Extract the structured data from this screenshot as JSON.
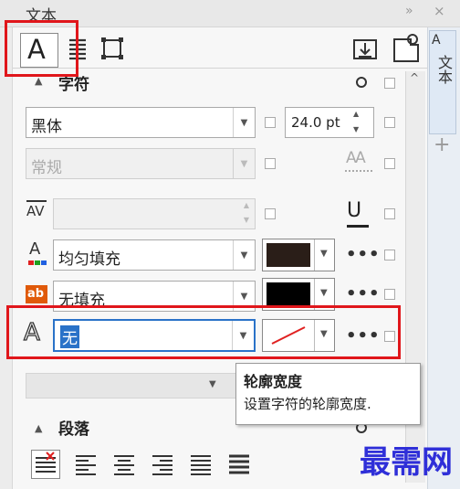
{
  "title_bar": {
    "title": "文本",
    "expand_glyph": "»",
    "close_glyph": "×"
  },
  "toolbar": {
    "char_icon_glyph": "A",
    "para_icon": "paragraph-icon",
    "frame_icon": "frame-icon",
    "import_icon": "import-icon",
    "settings_icon": "settings-icon"
  },
  "right_dock": {
    "tab_label": "文本",
    "add_glyph": "+",
    "tab_icon_glyph": "A"
  },
  "character": {
    "section_label": "字符",
    "font_name": "黑体",
    "font_size": "24.0 pt",
    "font_style": "常规",
    "kerning_value": "",
    "fill_type": "均匀填充",
    "fill_color": "#2a1e18",
    "background_fill": "无填充",
    "background_color": "#000000",
    "outline": "无",
    "outline_color": "#e02020",
    "more_glyph": "•••"
  },
  "tooltip": {
    "title": "轮廓宽度",
    "text": "设置字符的轮廓宽度."
  },
  "paragraph": {
    "section_label": "段落"
  },
  "highlight_color": "#e0161b",
  "watermark": "最需网"
}
